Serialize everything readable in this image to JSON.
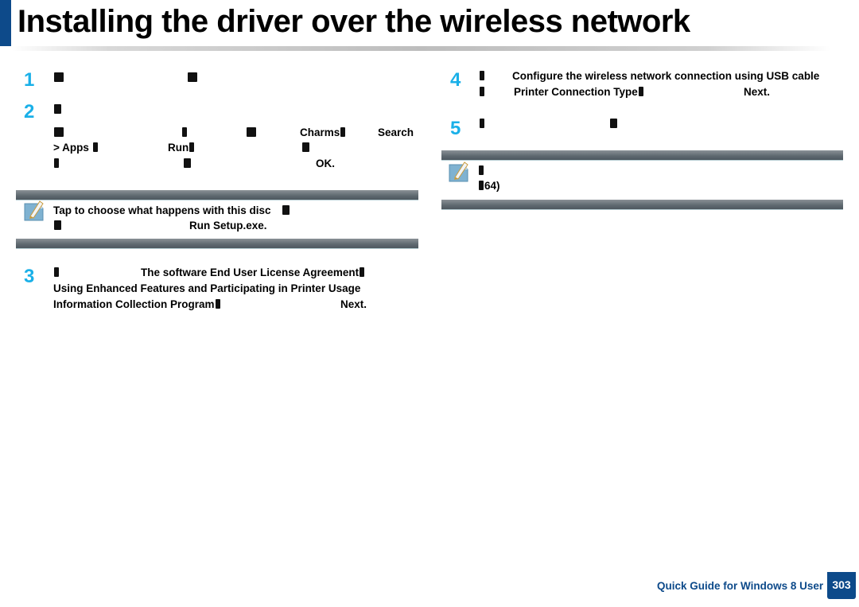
{
  "header": {
    "title": "Installing the driver over the wireless network",
    "accent_color": "#0d4a8a"
  },
  "left_column": {
    "steps": [
      {
        "number": "1"
      },
      {
        "number": "2",
        "fragments": {
          "charms": "Charms",
          "search": "Search",
          "apps": "> Apps",
          "run": "Run",
          "ok": "OK."
        }
      },
      {
        "number": "3",
        "fragments": {
          "eula": "The software End User License Agreement",
          "enhanced": "Using Enhanced Features and Participating in Printer Usage",
          "program": "Information Collection Program",
          "next": "Next."
        }
      }
    ],
    "note": {
      "icon": "note-pencil-icon",
      "line1": "Tap to choose what happens with this disc",
      "run_setup": "Run Setup.exe."
    }
  },
  "right_column": {
    "steps": [
      {
        "number": "4",
        "fragments": {
          "configure": "Configure the wireless network connection using USB cable",
          "connection_type": "Printer Connection Type",
          "next": "Next."
        }
      },
      {
        "number": "5"
      }
    ],
    "note": {
      "icon": "note-pencil-icon",
      "page_ref": "64)"
    }
  },
  "footer": {
    "guide_label": "Quick Guide for Windows 8 User",
    "page_number": "303",
    "step_color": "#1ab0e8"
  }
}
